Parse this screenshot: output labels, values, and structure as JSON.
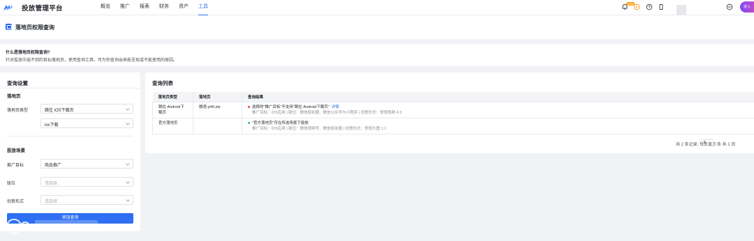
{
  "topnav": {
    "brand": "投放管理平台",
    "items": [
      {
        "label": "概览",
        "active": false
      },
      {
        "label": "推广",
        "active": false
      },
      {
        "label": "报表",
        "active": false
      },
      {
        "label": "财务",
        "active": false
      },
      {
        "label": "资产",
        "active": false
      },
      {
        "label": "工具",
        "active": true
      }
    ],
    "new_badge": "New",
    "enter_button": "进入"
  },
  "page": {
    "title": "落地页权限查询"
  },
  "info": {
    "title": "什么是落地页权限查询?",
    "desc": "针对投放中选不到的目标落地页，使用查询工具，可为你查询出来能呈现或不能使用的原因。"
  },
  "left": {
    "title": "查询设置",
    "landing_group": "落地页",
    "type_label": "落地页类型",
    "type_value": "跳往 iOS下载页",
    "type_sub_value": "ios下载",
    "scene_group": "投放场景",
    "target_label": "推广目标",
    "target_value": "商品推广",
    "position_label": "版位",
    "position_placeholder": "请选择",
    "creative_label": "创意形式",
    "creative_placeholder": "请选择",
    "submit_label": "添加查询"
  },
  "right": {
    "title": "查询列表",
    "columns": [
      "落地页类型",
      "落地页",
      "查询结果"
    ],
    "rows": [
      {
        "type": "跳往 Android下载页",
        "page": "微语-p40.zip",
        "status_color": "#f04142",
        "result": "选择的\"推广目标\"不支持\"跳往 Android下载页\"",
        "link": "详情",
        "sub": "推广目标：iOS应用 | 版位：微信朋友圈、微信公众号与小程序 | 创意形式：常规视频 4:3"
      },
      {
        "type": "官方落地页",
        "page": "",
        "status_color": "#2fbf71",
        "result": "\"官方落地页\"可在所选场景下投放",
        "link": "",
        "sub": "推广目标：iOS应用 | 版位：微信视频号、微信朋友圈 | 创意形式：常规大图 1:1"
      }
    ],
    "pager": {
      "total_text": "共 2 条记录, 每页显示",
      "page_size": "5",
      "pages_text": "条 共 1 页"
    }
  },
  "colors": {
    "accent": "#2e6ff4",
    "error": "#f04142",
    "success": "#2fbf71"
  }
}
